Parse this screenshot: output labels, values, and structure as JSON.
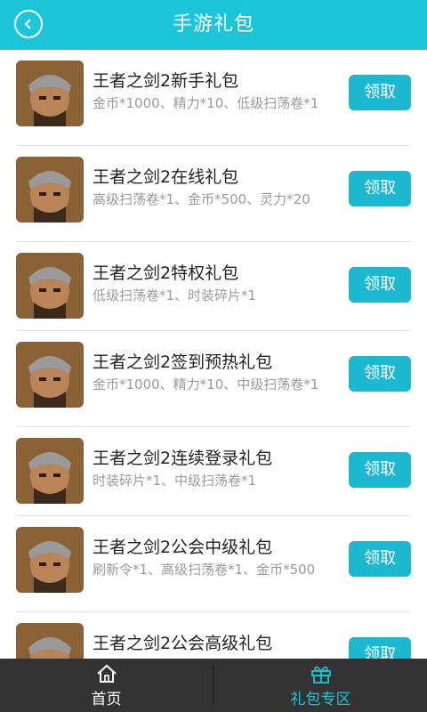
{
  "header": {
    "title": "手游礼包",
    "back_icon": "back-arrow-icon"
  },
  "theme": {
    "accent": "#1cc6d8",
    "button": "#1cb8cf",
    "nav_bg": "#333333"
  },
  "gifts": [
    {
      "title": "王者之剑2新手礼包",
      "desc": "金币*1000、精力*10、低级扫荡卷*1",
      "button": "领取"
    },
    {
      "title": "王者之剑2在线礼包",
      "desc": "高级扫荡卷*1、金币*500、灵力*20",
      "button": "领取"
    },
    {
      "title": "王者之剑2特权礼包",
      "desc": "低级扫荡卷*1、时装碎片*1",
      "button": "领取"
    },
    {
      "title": "王者之剑2签到预热礼包",
      "desc": "金币*1000、精力*10、中级扫荡卷*1",
      "button": "领取"
    },
    {
      "title": "王者之剑2连续登录礼包",
      "desc": "时装碎片*1、中级扫荡卷*1",
      "button": "领取"
    },
    {
      "title": "王者之剑2公会中级礼包",
      "desc": "刷新令*1、高级扫荡卷*1、金币*500",
      "button": "领取"
    },
    {
      "title": "王者之剑2公会高级礼包",
      "desc": "",
      "button": "领取"
    }
  ],
  "nav": {
    "home": {
      "label": "首页",
      "icon": "home-icon"
    },
    "gifts": {
      "label": "礼包专区",
      "icon": "gift-icon"
    }
  }
}
